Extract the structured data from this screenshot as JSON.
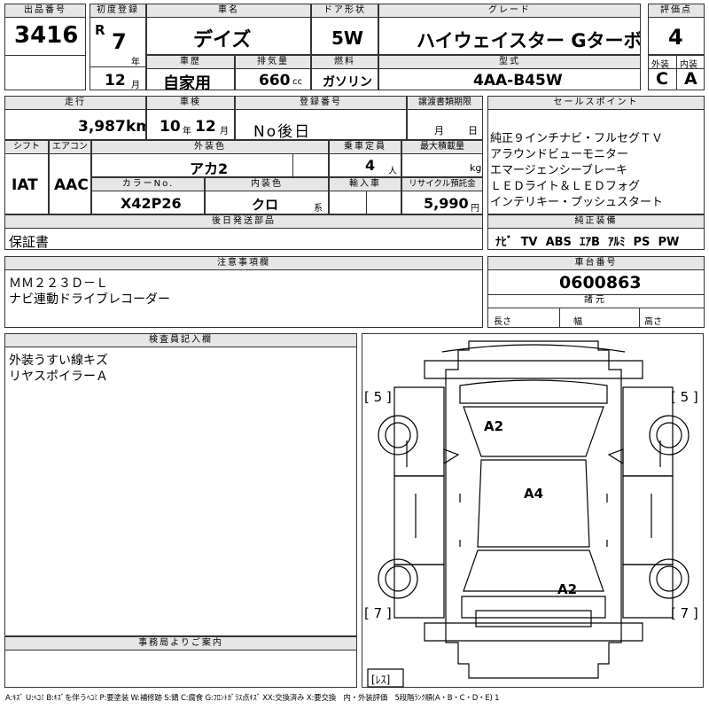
{
  "header": {
    "lot_label": "出品番号",
    "lot_value": "3416",
    "first_reg_label": "初度登録",
    "era": "R",
    "year": "7",
    "year_unit": "年",
    "month": "12",
    "month_unit": "月",
    "car_name_label": "車名",
    "car_name": "デイズ",
    "door_label": "ドア形状",
    "door": "5W",
    "grade_label": "グレード",
    "grade": "ハイウェイスター Gターボ",
    "score_label": "評価点",
    "score": "4",
    "history_label": "車歴",
    "history": "自家用",
    "displacement_label": "排気量",
    "displacement": "660",
    "cc": "cc",
    "fuel_label": "燃料",
    "fuel": "ガソリン",
    "model_label": "型式",
    "model": "4AA-B45W",
    "ext_label": "外装",
    "int_label": "内装",
    "ext_grade": "C",
    "int_grade": "A"
  },
  "row2": {
    "mileage_label": "走行",
    "mileage": "3,987",
    "km": "km",
    "inspection_label": "車検",
    "insp_year": "10",
    "insp_year_unit": "年",
    "insp_month": "12",
    "insp_month_unit": "月",
    "regno_label": "登録番号",
    "regno": "No後日",
    "transfer_label": "譲渡書類期限",
    "transfer_month": "月",
    "transfer_day": "日",
    "shift_label": "シフト",
    "shift": "IAT",
    "ac_label": "エアコン",
    "ac": "AAC",
    "color_label": "外装色",
    "color": "アカ2",
    "capacity_label": "乗車定員",
    "capacity": "4",
    "capacity_unit": "人",
    "load_label": "最大積載量",
    "load_unit": "kg",
    "colorno_label": "カラーNo.",
    "colorno": "X42P26",
    "intcolor_label": "内装色",
    "intcolor": "クロ",
    "intcolor_unit": "系",
    "import_label": "輸入車",
    "recycle_label": "リサイクル預託金",
    "recycle": "5,990",
    "recycle_unit": "円",
    "later_label": "後日発送部品",
    "later": "保証書"
  },
  "sales": {
    "label": "セールスポイント",
    "points": [
      "純正９インチナビ・フルセグＴＶ",
      "アラウンドビューモニター",
      "エマージェンシーブレーキ",
      "ＬＥＤライト＆ＬＥＤフォグ",
      "インテリキー・プッシュスタート"
    ],
    "equip_label": "純正装備",
    "equipment": [
      "ﾅﾋﾞ",
      "TV",
      "ABS",
      "ｴｱB",
      "ｱﾙﾐ",
      "PS",
      "PW"
    ]
  },
  "notes": {
    "label": "注意事項欄",
    "lines": [
      "ＭＭ２２３Ｄ－Ｌ",
      "ナビ連動ドライブレコーダー"
    ]
  },
  "chassis": {
    "label": "車台番号",
    "value": "0600863",
    "dims_label": "諸元",
    "length": "長さ",
    "width": "幅",
    "height": "高さ"
  },
  "inspector": {
    "label": "検査員記入欄",
    "lines": [
      "外装うすい線キズ",
      "リヤスポイラーＡ"
    ]
  },
  "office": {
    "label": "事務局よりご案内"
  },
  "diagram": {
    "tl": "[ 5 ]",
    "tr": "[ 5 ]",
    "bl": "[ 7 ]",
    "br": "[ 7 ]",
    "rest": "[ﾚｽ]",
    "mark1": "A2",
    "mark2": "A4",
    "mark3": "A2"
  },
  "legend": "A:ｷｽﾞ U:ﾍｺﾐ B:ｷｽﾞを伴うﾍｺﾐ P:要塗装 W:補修跡 S:錆 C:腐食 G:ﾌﾛﾝﾄｶﾞﾗｽ点ｷｽﾞ XX:交換済み X:要交換　内・外装評価　5段階ﾗﾝｸ順(A・B・C・D・E) 1"
}
